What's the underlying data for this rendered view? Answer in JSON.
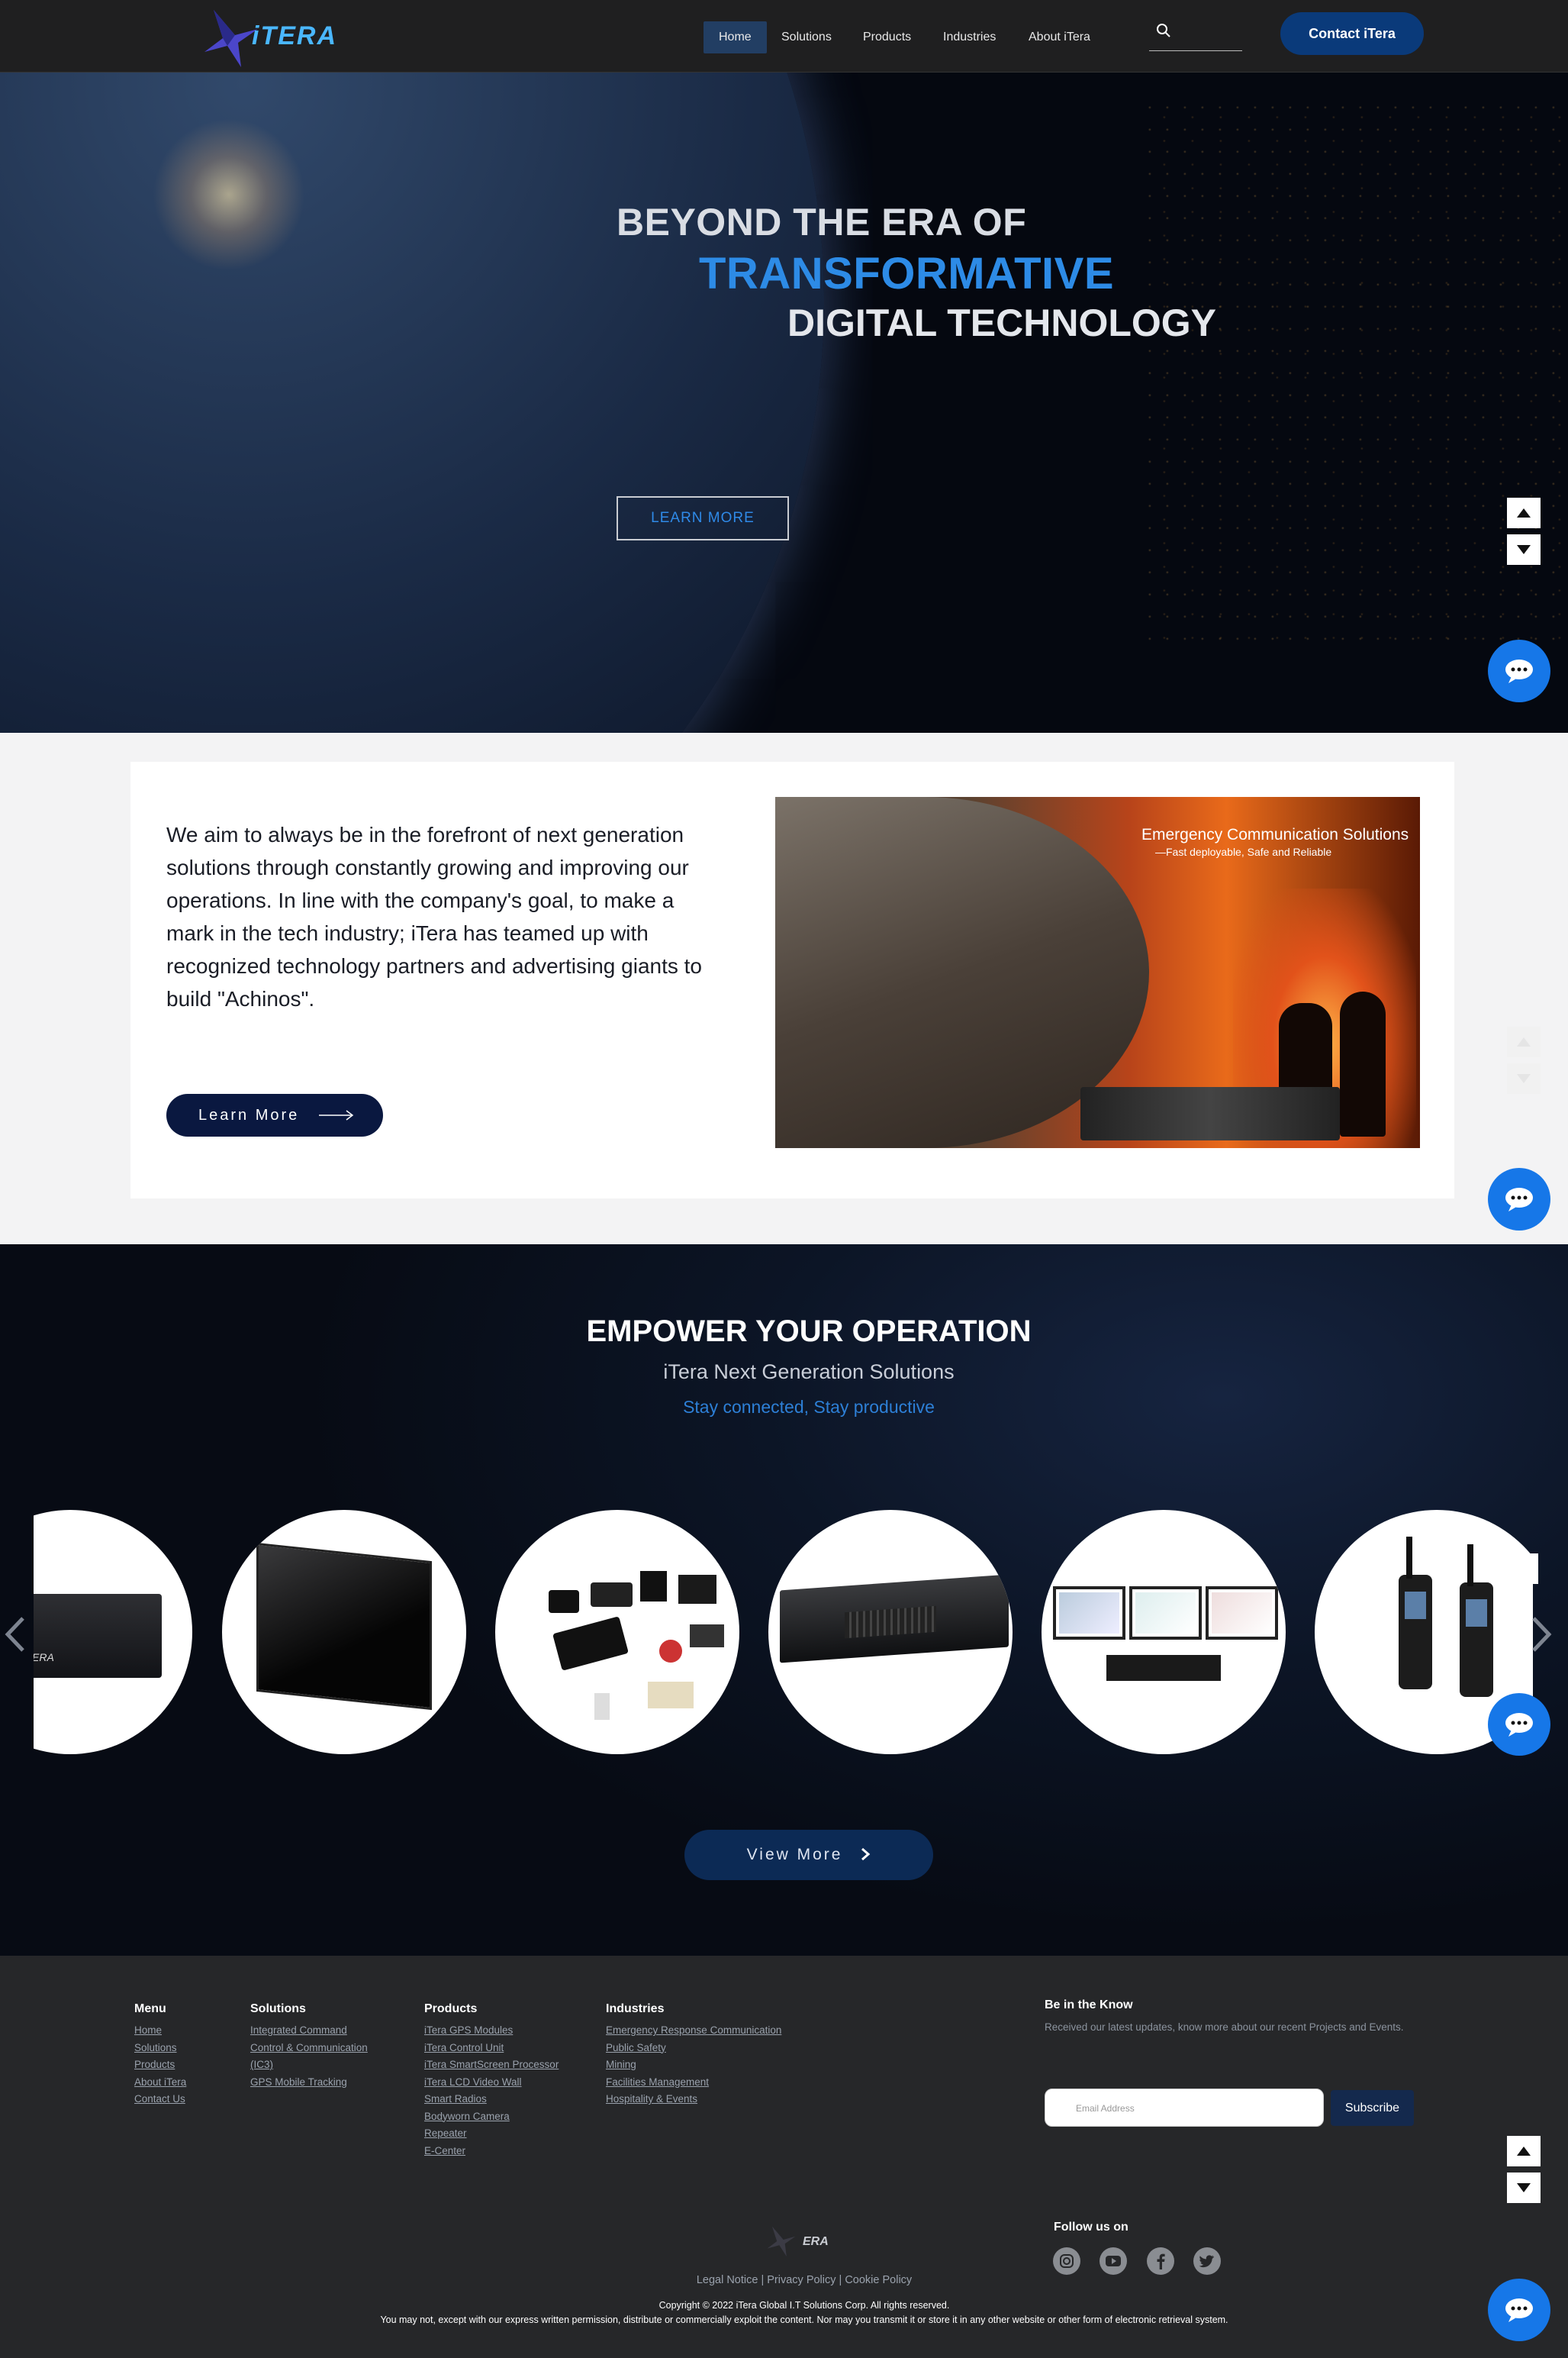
{
  "header": {
    "logo_text": "iTERA",
    "nav": [
      "Home",
      "Solutions",
      "Products",
      "Industries",
      "About iTera"
    ],
    "contact_label": "Contact iTera"
  },
  "hero": {
    "line1": "BEYOND THE ERA OF",
    "line2": "TRANSFORMATIVE",
    "line3": "DIGITAL TECHNOLOGY",
    "button": "LEARN MORE"
  },
  "about": {
    "text": "We aim to always be in the forefront of next generation solutions through constantly growing and improving our operations. In line with the company's goal, to make a mark in the tech industry; iTera has teamed up with recognized technology partners and advertising giants to build \"Achinos\".",
    "button": "Learn More",
    "image_title": "Emergency Communication Solutions",
    "image_subtitle": "—Fast deployable, Safe and Reliable"
  },
  "solutions": {
    "title": "EMPOWER YOUR OPERATION",
    "subtitle": "iTera Next Generation Solutions",
    "tagline": "Stay connected, Stay productive",
    "view_more": "View More"
  },
  "footer": {
    "menu": {
      "title": "Menu",
      "links": [
        "Home",
        "Solutions",
        "Products",
        "About iTera",
        "Contact Us"
      ]
    },
    "solutions": {
      "title": "Solutions",
      "links": [
        "Integrated Command",
        "Control & Communication",
        "(IC3)",
        "GPS Mobile Tracking"
      ]
    },
    "products": {
      "title": "Products",
      "links": [
        "iTera GPS Modules",
        "iTera Control Unit",
        "iTera SmartScreen Processor",
        "iTera LCD Video Wall",
        "Smart Radios",
        "Bodyworn Camera",
        "Repeater",
        "E-Center"
      ]
    },
    "industries": {
      "title": "Industries",
      "links": [
        "Emergency Response Communication",
        "Public Safety",
        "Mining",
        "Facilities Management",
        "Hospitality & Events"
      ]
    },
    "newsletter": {
      "title": "Be in the Know",
      "text": "Received our latest updates, know more about our recent Projects and Events.",
      "placeholder": "Email Address",
      "button": "Subscribe"
    },
    "follow": "Follow us on",
    "logo_text": "ERA",
    "legal": [
      "Legal Notice",
      "Privacy Policy",
      "Cookie Policy"
    ],
    "copyright": "Copyright © 2022 iTera Global I.T Solutions Corp. All rights reserved.",
    "disclaimer": "You may not, except with our express written permission, distribute or commercially exploit the content. Nor may you transmit it or store it in any other website or other form of electronic retrieval system."
  },
  "colors": {
    "accent": "#2d8be6",
    "nav_active": "#223e63",
    "contact_button": "#0a3a7a",
    "chat": "#1677e8"
  }
}
